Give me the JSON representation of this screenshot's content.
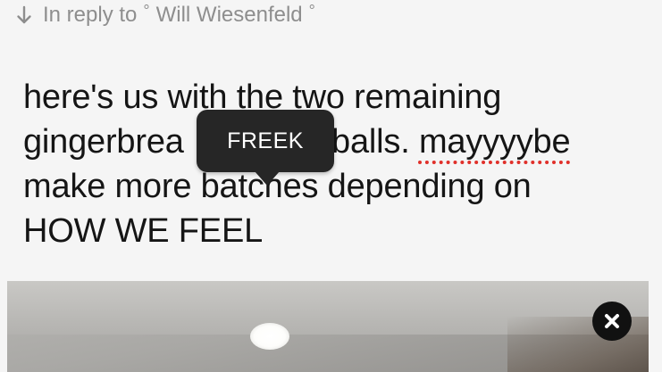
{
  "reply": {
    "prefix": "In reply to",
    "user": "Will Wiesenfeld",
    "degree_symbol": "°"
  },
  "post": {
    "lines": [
      "here's us with the two remaining",
      "gingerbread cookie dough balls.",
      "make more batches depending on",
      "HOW WE FEEL"
    ],
    "line2_start": "gingerbrea",
    "line2_end": " balls. ",
    "misspelled_word": "mayyyybe"
  },
  "tooltip": {
    "label": "FREEK"
  },
  "icons": {
    "reply_arrow": "arrow-down-icon",
    "close": "close-icon"
  },
  "colors": {
    "background": "#f5f5f5",
    "text": "#151515",
    "muted": "#8e8e8e",
    "tooltip_bg": "#262626",
    "spell_underline": "#e0302a"
  }
}
